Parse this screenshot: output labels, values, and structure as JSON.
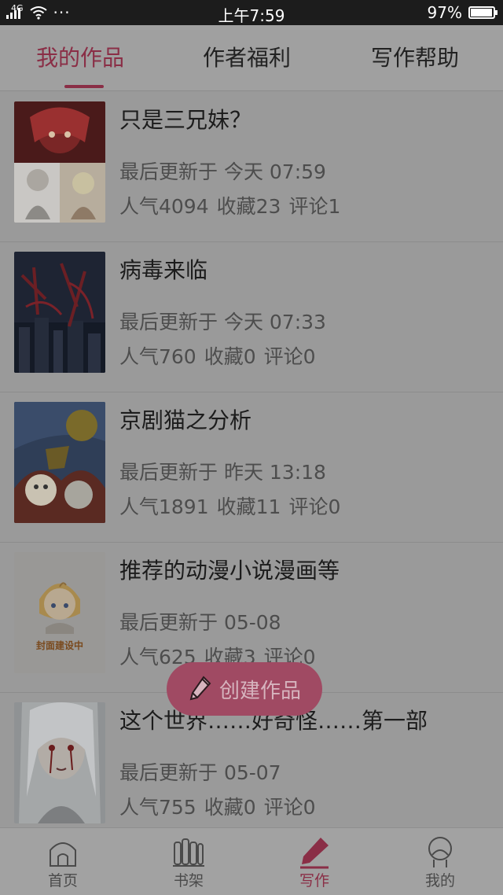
{
  "status_bar": {
    "network": "4G",
    "dots": "···",
    "time": "上午7:59",
    "battery_text": "97%",
    "battery_level": 0.97
  },
  "top_tabs": [
    {
      "label": "我的作品",
      "active": true
    },
    {
      "label": "作者福利",
      "active": false
    },
    {
      "label": "写作帮助",
      "active": false
    }
  ],
  "works": [
    {
      "title": "只是三兄妹？",
      "updated": "最后更新于 今天 07:59",
      "popularity": "人气4094",
      "favorites": "收藏23",
      "comments": "评论1",
      "cover_icon": "anime-cover-red-icon"
    },
    {
      "title": "病毒来临",
      "updated": "最后更新于 今天 07:33",
      "popularity": "人气760",
      "favorites": "收藏0",
      "comments": "评论0",
      "cover_icon": "dark-city-cover-icon"
    },
    {
      "title": "京剧猫之分析",
      "updated": "最后更新于 昨天 13:18",
      "popularity": "人气1891",
      "favorites": "收藏11",
      "comments": "评论0",
      "cover_icon": "opera-cat-cover-icon"
    },
    {
      "title": "推荐的动漫小说漫画等",
      "updated": "最后更新于 05-08",
      "popularity": "人气625",
      "favorites": "收藏3",
      "comments": "评论0",
      "cover_icon": "default-cover-icon",
      "cover_caption": "封面建设中"
    },
    {
      "title": "这个世界……好奇怪……第一部",
      "updated": "最后更新于 05-07",
      "popularity": "人气755",
      "favorites": "收藏0",
      "comments": "评论0",
      "cover_icon": "sketch-girl-cover-icon"
    }
  ],
  "create_button": {
    "label": "创建作品",
    "icon": "pencil-icon"
  },
  "bottom_nav": [
    {
      "label": "首页",
      "icon": "home-icon",
      "active": false
    },
    {
      "label": "书架",
      "icon": "bookshelf-icon",
      "active": false
    },
    {
      "label": "写作",
      "icon": "pen-icon",
      "active": true
    },
    {
      "label": "我的",
      "icon": "profile-icon",
      "active": false
    }
  ],
  "colors": {
    "accent": "#8a2e46",
    "create_button_bg": "#a04a63",
    "status_bar_bg": "#1c1c1c",
    "overlay_bg": "#9a9a9a"
  }
}
